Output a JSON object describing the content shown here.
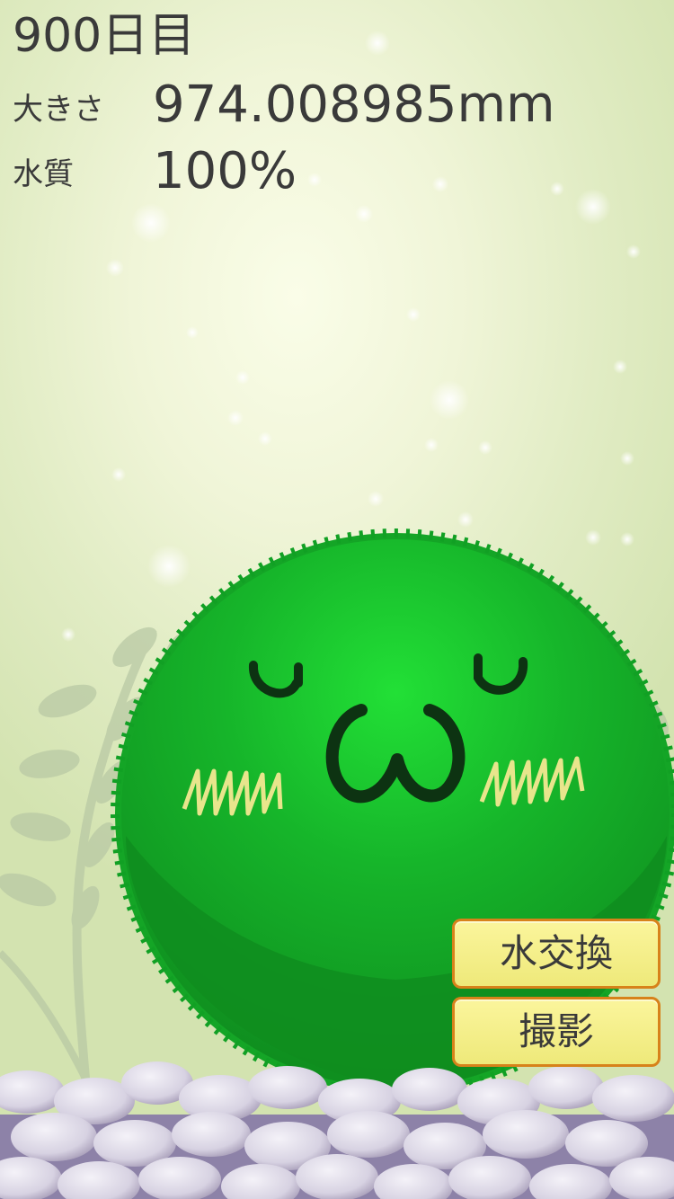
{
  "status": {
    "day": "900日目",
    "size_label": "大きさ",
    "size_value": "974.008985mm",
    "quality_label": "水質",
    "quality_value": "100%"
  },
  "character": {
    "face": "ᵕ ω ᵕ",
    "color": "#1fc02f"
  },
  "buttons": {
    "water_change": "水交換",
    "photo": "撮影"
  },
  "colors": {
    "button_fill": "#f5f08a",
    "button_border": "#d7821a",
    "text": "#3a3a3a"
  }
}
